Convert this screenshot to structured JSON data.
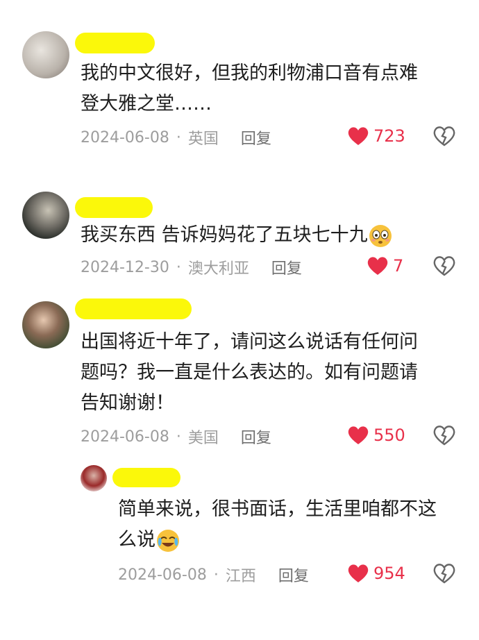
{
  "comments": [
    {
      "text_line1": "我的中文很好，但我的利物浦口音有点难",
      "text_line2": "登大雅之堂……",
      "date": "2024-06-08",
      "location": "英国",
      "reply_label": "回复",
      "likes": "723"
    },
    {
      "text_line1": "我买东西 告诉妈妈花了五块七十九",
      "date": "2024-12-30",
      "location": "澳大利亚",
      "reply_label": "回复",
      "likes": "7"
    },
    {
      "text_line1": "出国将近十年了，请问这么说话有任何问",
      "text_line2": "题吗？我一直是什么表达的。如有问题请",
      "text_line3": "告知谢谢！",
      "date": "2024-06-08",
      "location": "美国",
      "reply_label": "回复",
      "likes": "550"
    }
  ],
  "reply": {
    "text_line1": "简单来说，很书面话，生活里咱都不这",
    "text_line2": "么说",
    "date": "2024-06-08",
    "location": "江西",
    "reply_label": "回复",
    "likes": "954"
  },
  "colors": {
    "name_highlight": "#fbf80a",
    "like_red": "#e8304a",
    "meta_gray": "#9d9d9d"
  }
}
